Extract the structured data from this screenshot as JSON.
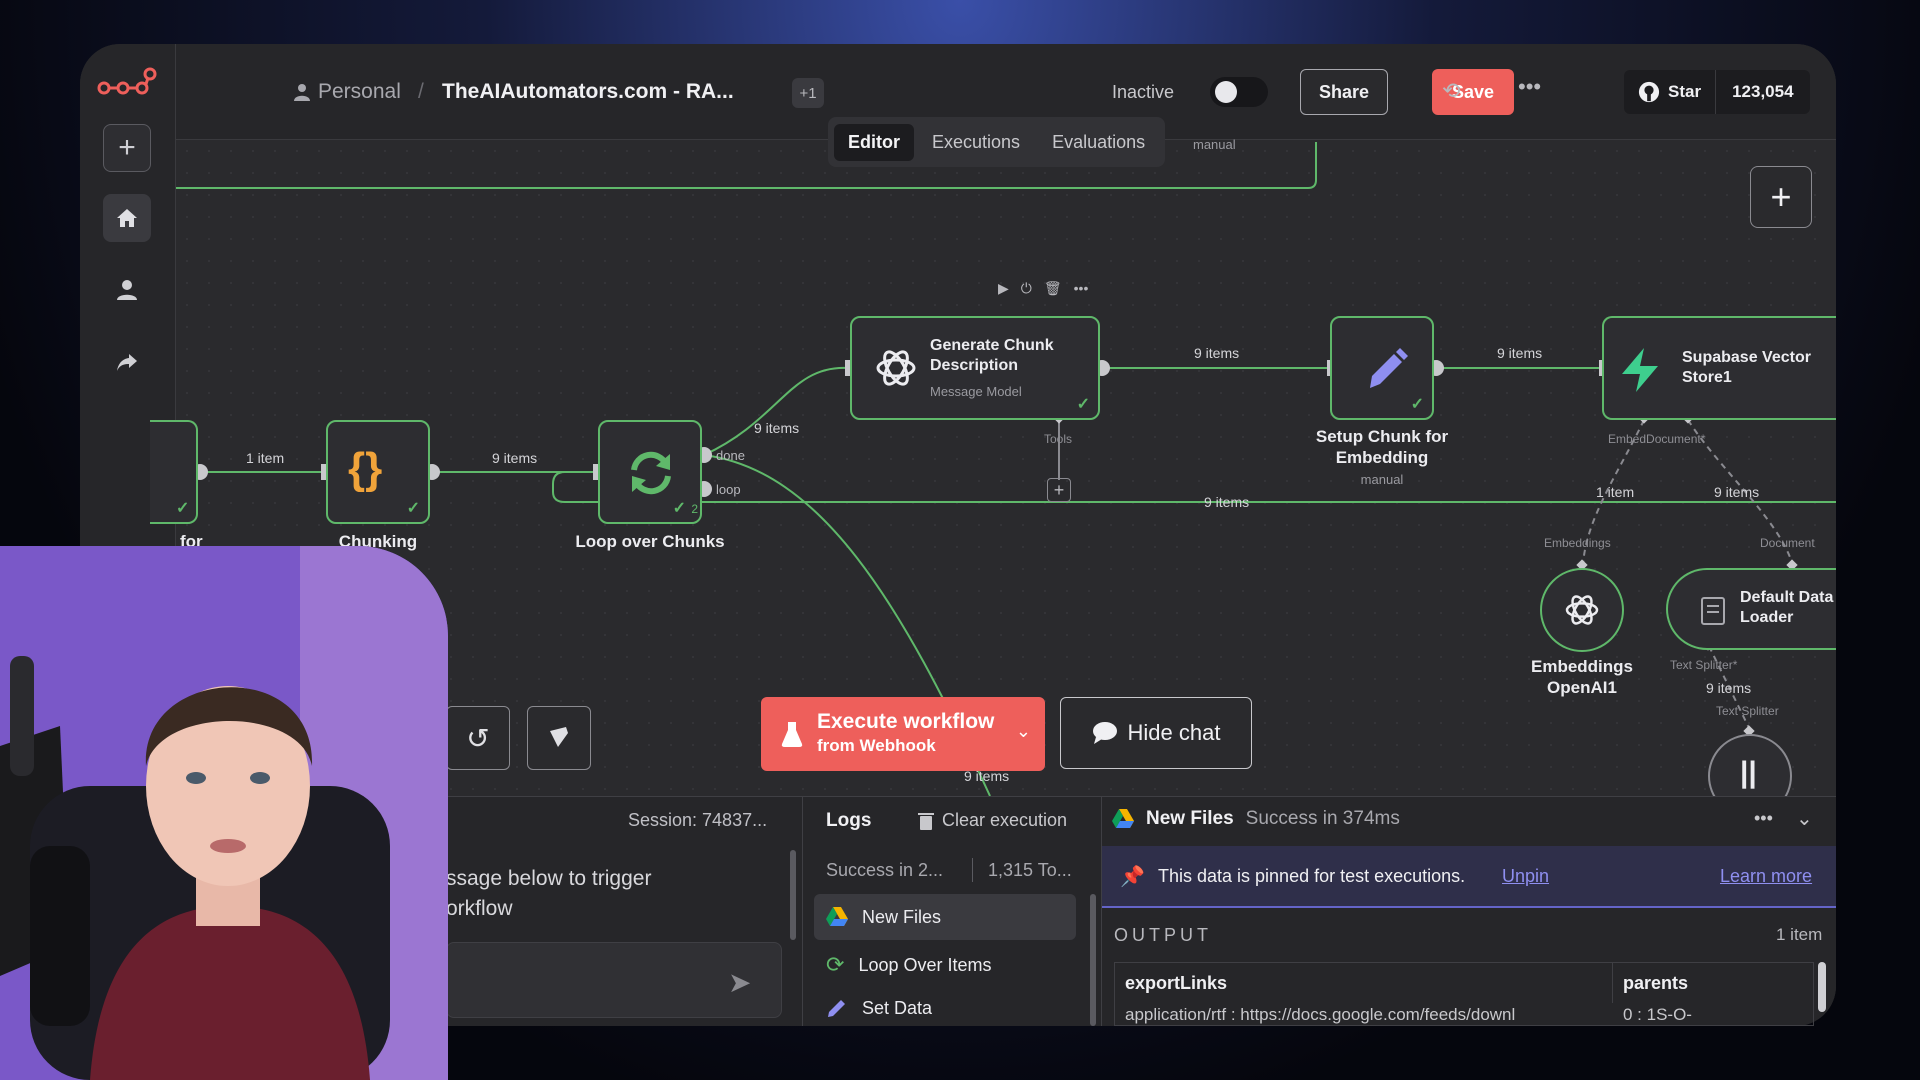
{
  "header": {
    "workspace": "Personal",
    "separator": "/",
    "workflow_title": "TheAIAutomators.com - RA...",
    "tag_count": "+1",
    "status_label": "Inactive",
    "share_label": "Share",
    "save_label": "Save",
    "github_star": "Star",
    "github_count": "123,054"
  },
  "tabs": [
    {
      "label": "Editor",
      "active": true
    },
    {
      "label": "Executions"
    },
    {
      "label": "Evaluations"
    }
  ],
  "canvas": {
    "top_manual_label": "manual",
    "nodes": {
      "partial_label": "for",
      "chunking": "Chunking",
      "loop": "Loop over Chunks",
      "loop_done": "done",
      "loop_loop": "loop",
      "loop_badge": "2",
      "generate_title": "Generate Chunk Description",
      "generate_sub": "Message Model",
      "generate_tools": "Tools",
      "setup_title": "Setup Chunk for Embedding",
      "setup_sub": "manual",
      "supabase_title": "Supabase Vector Store1",
      "supabase_port": "EmbedDocument*",
      "embeddings_port": "Embeddings",
      "document_port": "Document",
      "embeddings_title": "Embeddings OpenAI1",
      "loader_title": "Default Data Loader",
      "text_splitter_port": "Text Splitter*",
      "text_splitter_label": "Text Splitter"
    },
    "edges": {
      "e1": "1 item",
      "e2": "9 items",
      "e3": "9 items",
      "e4": "9 items",
      "e5": "9 items",
      "e6": "9 items",
      "e7": "1 item",
      "e8": "9 items",
      "e9": "9 items",
      "e10": "9 items"
    },
    "execute_main": "Execute workflow",
    "execute_sub": "from Webhook",
    "hide_chat": "Hide chat"
  },
  "chat": {
    "session": "Session: 74837...",
    "message_line1": "ssage below to trigger",
    "message_line2": "orkflow"
  },
  "logs": {
    "title": "Logs",
    "clear": "Clear execution",
    "summary_status": "Success in 2...",
    "summary_tokens": "1,315 To...",
    "items": [
      {
        "label": "New Files",
        "icon": "google-drive-icon",
        "active": true
      },
      {
        "label": "Loop Over Items",
        "icon": "loop-icon"
      },
      {
        "label": "Set Data",
        "icon": "pencil-icon"
      }
    ]
  },
  "output": {
    "node_name": "New Files",
    "status": "Success in 374ms",
    "pinned_text": "This data is pinned for test executions.",
    "unpin": "Unpin",
    "learn_more": "Learn more",
    "label": "OUTPUT",
    "count": "1 item",
    "columns": [
      "exportLinks",
      "parents"
    ],
    "row": [
      "application/rtf : https://docs.google.com/feeds/downl",
      "0 : 1S-O-"
    ]
  },
  "colors": {
    "success": "#5fb86a",
    "accent": "#ee5f5b",
    "pinned": "#6464c8"
  }
}
